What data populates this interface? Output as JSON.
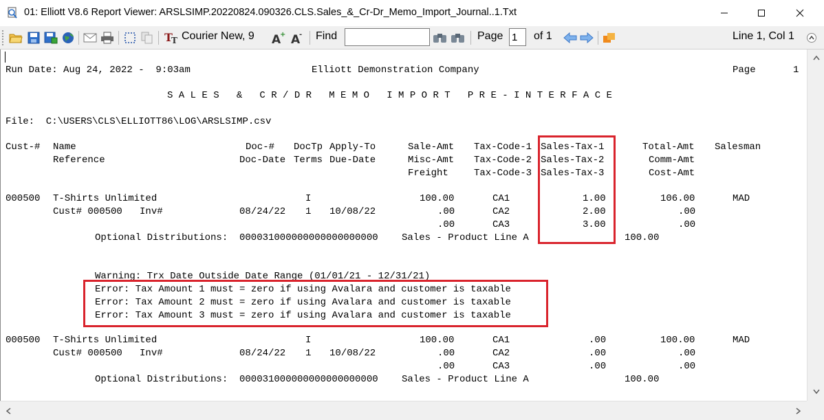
{
  "window": {
    "title": "01: Elliott V8.6 Report Viewer: ARSLSIMP.20220824.090326.CLS.Sales_&_Cr-Dr_Memo_Import_Journal..1.Txt",
    "minimize_icon": "minimize-icon",
    "maximize_icon": "maximize-icon",
    "close_icon": "close-icon"
  },
  "toolbar": {
    "font_label": "Courier New, 9",
    "find_label": "Find",
    "find_value": "",
    "page_label": "Page",
    "page_value": "1",
    "page_of": "of 1",
    "position": "Line 1, Col 1",
    "accent_color": "#3b8ee8"
  },
  "report": {
    "header": {
      "run_date": "Run Date: Aug 24, 2022 -  9:03am",
      "company": "Elliott Demonstration Company",
      "page_label": "Page",
      "page_number": "1",
      "title": "S A L E S   &   C R / D R   M E M O   I M P O R T   P R E - I N T E R F A C E",
      "file_line": "File:  C:\\USERS\\CLS\\ELLIOTT86\\LOG\\ARSLSIMP.csv"
    },
    "columns": {
      "row1": [
        "Cust-#",
        "Name",
        "Doc-#",
        "DocTp",
        "Apply-To",
        "Sale-Amt",
        "Tax-Code-1",
        "Sales-Tax-1",
        "Total-Amt",
        "Salesman"
      ],
      "row2": [
        "Reference",
        "Doc-Date",
        "Terms",
        "Due-Date",
        "Misc-Amt",
        "Tax-Code-2",
        "Sales-Tax-2",
        "Comm-Amt"
      ],
      "row3": [
        "Freight",
        "Tax-Code-3",
        "Sales-Tax-3",
        "Cost-Amt"
      ]
    },
    "records": [
      {
        "line1": {
          "cust": "000500",
          "name": "T-Shirts Unlimited",
          "doctp": "I",
          "sale_amt": "100.00",
          "tax_code": "CA1",
          "sales_tax": "1.00",
          "total": "106.00",
          "salesman": "MAD"
        },
        "line2": {
          "ref": "Cust# 000500   Inv#",
          "doc_date": "08/24/22",
          "terms": "1",
          "due_date": "10/08/22",
          "misc": ".00",
          "tax_code": "CA2",
          "sales_tax": "2.00",
          "comm": ".00"
        },
        "line3": {
          "freight": ".00",
          "tax_code": "CA3",
          "sales_tax": "3.00",
          "cost": ".00"
        },
        "dist": {
          "label": "Optional Distributions:",
          "account": "000031000000000000000000",
          "desc": "Sales - Product Line A",
          "amount": "100.00"
        },
        "warning": "Warning: Trx Date Outside Date Range (01/01/21 - 12/31/21)",
        "errors": [
          "Error: Tax Amount 1 must = zero if using Avalara and customer is taxable",
          "Error: Tax Amount 2 must = zero if using Avalara and customer is taxable",
          "Error: Tax Amount 3 must = zero if using Avalara and customer is taxable"
        ]
      },
      {
        "line1": {
          "cust": "000500",
          "name": "T-Shirts Unlimited",
          "doctp": "I",
          "sale_amt": "100.00",
          "tax_code": "CA1",
          "sales_tax": ".00",
          "total": "100.00",
          "salesman": "MAD"
        },
        "line2": {
          "ref": "Cust# 000500   Inv#",
          "doc_date": "08/24/22",
          "terms": "1",
          "due_date": "10/08/22",
          "misc": ".00",
          "tax_code": "CA2",
          "sales_tax": ".00",
          "comm": ".00"
        },
        "line3": {
          "freight": ".00",
          "tax_code": "CA3",
          "sales_tax": ".00",
          "cost": ".00"
        },
        "dist": {
          "label": "Optional Distributions:",
          "account": "000031000000000000000000",
          "desc": "Sales - Product Line A",
          "amount": "100.00"
        }
      }
    ],
    "highlight_color": "#d9232c"
  }
}
